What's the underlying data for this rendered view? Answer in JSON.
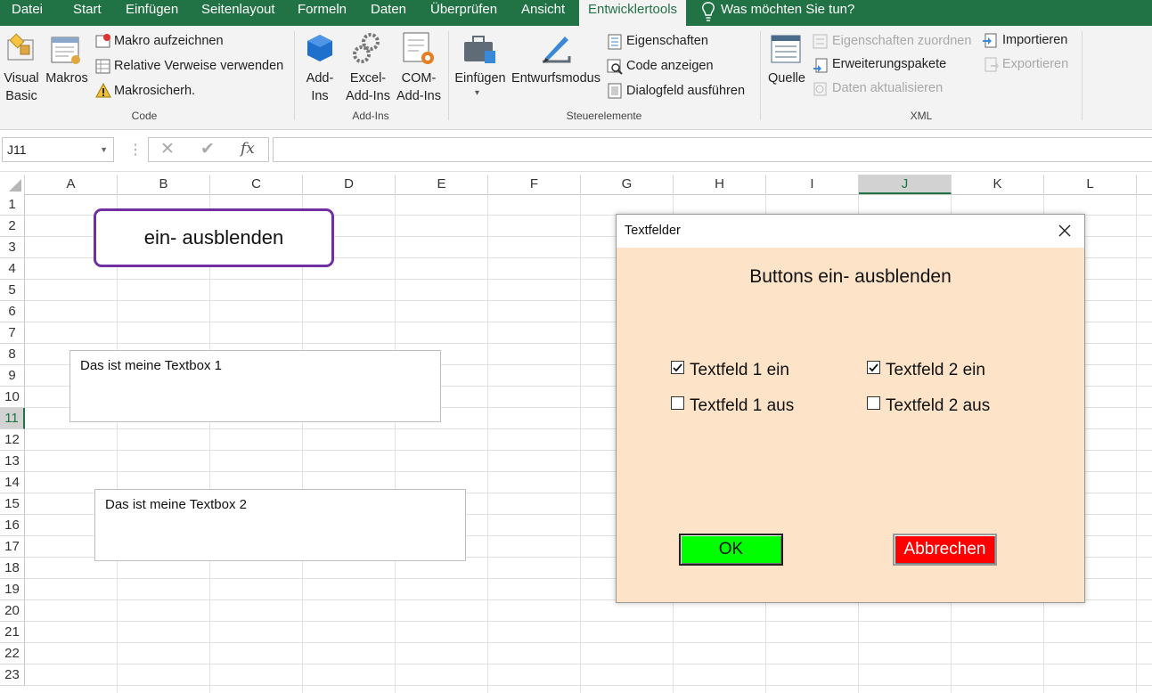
{
  "tabs": [
    "Datei",
    "Start",
    "Einfügen",
    "Seitenlayout",
    "Formeln",
    "Daten",
    "Überprüfen",
    "Ansicht",
    "Entwicklertools"
  ],
  "tell_me": "Was möchten Sie tun?",
  "ribbon": {
    "code": {
      "visual_basic": "Visual Basic",
      "makros": "Makros",
      "makro_aufzeichnen": "Makro aufzeichnen",
      "relative_verweise": "Relative Verweise verwenden",
      "makrosicherheit": "Makrosicherh.",
      "group_label": "Code"
    },
    "addins": {
      "addins": "Add-Ins",
      "excel_addins": "Excel-Add-Ins",
      "com_addins": "COM-Add-Ins",
      "group_label": "Add-Ins"
    },
    "controls": {
      "einfuegen": "Einfügen",
      "entwurfsmodus": "Entwurfsmodus",
      "eigenschaften": "Eigenschaften",
      "code_anzeigen": "Code anzeigen",
      "dialogfeld": "Dialogfeld ausführen",
      "group_label": "Steuerelemente"
    },
    "xml": {
      "quelle": "Quelle",
      "eigenschaften_zuordnen": "Eigenschaften zuordnen",
      "erweiterungspakete": "Erweiterungspakete",
      "daten_aktualisieren": "Daten aktualisieren",
      "importieren": "Importieren",
      "exportieren": "Exportieren",
      "group_label": "XML"
    }
  },
  "formula_bar": {
    "name_box": "J11",
    "fx": "fx",
    "value": ""
  },
  "columns": [
    "A",
    "B",
    "C",
    "D",
    "E",
    "F",
    "G",
    "H",
    "I",
    "J",
    "K",
    "L"
  ],
  "selected_column": "J",
  "rows": [
    "1",
    "2",
    "3",
    "4",
    "5",
    "6",
    "7",
    "8",
    "9",
    "10",
    "11",
    "12",
    "13",
    "14",
    "15",
    "16",
    "17",
    "18",
    "19",
    "20",
    "21",
    "22",
    "23"
  ],
  "selected_row": "11",
  "sheet": {
    "shape_button": "ein- ausblenden",
    "textbox1": "Das ist meine Textbox 1",
    "textbox2": "Das ist meine Textbox 2"
  },
  "dialog": {
    "title": "Textfelder",
    "heading": "Buttons ein- ausblenden",
    "checkboxes": [
      {
        "label": "Textfeld 1 ein",
        "checked": true
      },
      {
        "label": "Textfeld 2 ein",
        "checked": true
      },
      {
        "label": "Textfeld 1 aus",
        "checked": false
      },
      {
        "label": "Textfeld 2 aus",
        "checked": false
      }
    ],
    "ok": "OK",
    "cancel": "Abbrechen",
    "ok_color": "#00ff00",
    "cancel_color": "#ff0000",
    "background": "#fde3c8"
  }
}
